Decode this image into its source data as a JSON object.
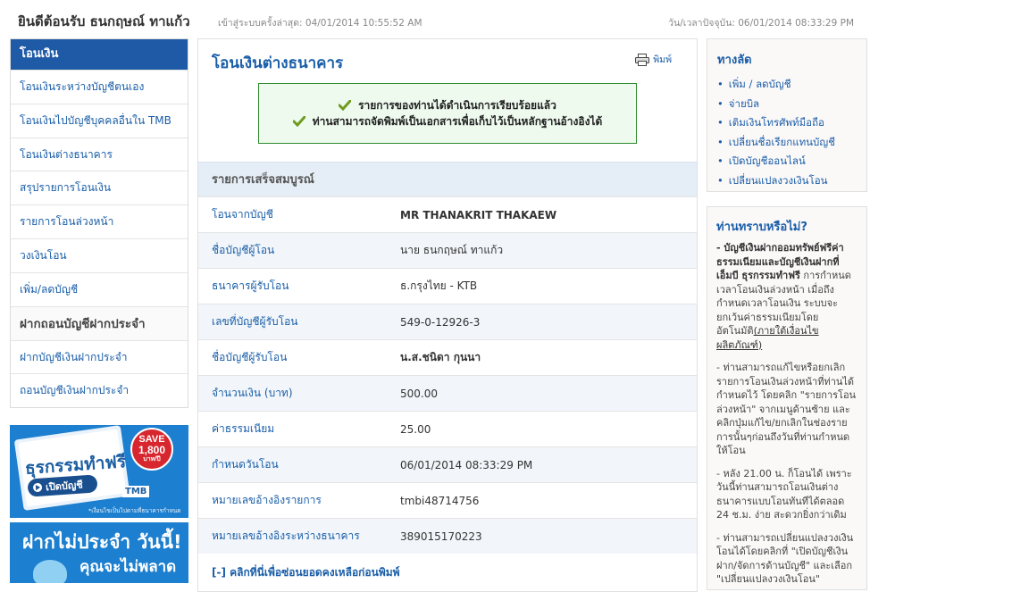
{
  "header": {
    "welcome": "ยินดีต้อนรับ ธนกฤษณ์ ทาแก้ว",
    "last_login": "เข้าสู่ระบบครั้งล่าสุด: 04/01/2014 10:55:52 AM",
    "current_time": "วัน/เวลาปัจจุบัน: 06/01/2014 08:33:29 PM"
  },
  "sidebar": {
    "title": "โอนเงิน",
    "items": [
      {
        "label": "โอนเงินระหว่างบัญชีตนเอง"
      },
      {
        "label": "โอนเงินไปบัญชีบุคคลอื่นใน TMB"
      },
      {
        "label": "โอนเงินต่างธนาคาร"
      },
      {
        "label": "สรุปรายการโอนเงิน"
      },
      {
        "label": "รายการโอนล่วงหน้า"
      },
      {
        "label": "วงเงินโอน"
      },
      {
        "label": "เพิ่ม/ลดบัญชี"
      }
    ],
    "section_title": "ฝากถอนบัญชีฝากประจำ",
    "section_items": [
      {
        "label": "ฝากบัญชีเงินฝากประจำ"
      },
      {
        "label": "ถอนบัญชีเงินฝากประจำ"
      }
    ]
  },
  "banner1": {
    "save_text": "SAVE",
    "save_amount": "1,800",
    "save_unit": "บาท/ปี",
    "title": "ธุรกรรมทำฟรี",
    "button": "เปิดบัญชี",
    "brand": "TMB",
    "note": "*เงื่อนไขเป็นไปตามที่ธนาคารกำหนด"
  },
  "banner2": {
    "line1": "ฝากไม่ประจำ วันนี้!",
    "line2": "คุณจะไม่พลาด"
  },
  "main": {
    "title": "โอนเงินต่างธนาคาร",
    "print_label": "พิมพ์",
    "success_lines": [
      "รายการของท่านได้ดำเนินการเรียบร้อยแล้ว",
      "ท่านสามารถจัดพิมพ์เป็นเอกสารเพื่อเก็บไว้เป็นหลักฐานอ้างอิงได้"
    ],
    "section_title": "รายการเสร็จสมบูรณ์",
    "rows": [
      {
        "label": "โอนจากบัญชี",
        "value": "MR THANAKRIT THAKAEW"
      },
      {
        "label": "ชื่อบัญชีผู้โอน",
        "value": "นาย ธนกฤษณ์ ทาแก้ว"
      },
      {
        "label": "ธนาคารผู้รับโอน",
        "value": "ธ.กรุงไทย - KTB"
      },
      {
        "label": "เลขที่บัญชีผู้รับโอน",
        "value": "549-0-12926-3"
      },
      {
        "label": "ชื่อบัญชีผู้รับโอน",
        "value": "น.ส.ชนิดา กุนนา"
      },
      {
        "label": "จำนวนเงิน (บาท)",
        "value": "500.00"
      },
      {
        "label": "ค่าธรรมเนียม",
        "value": "25.00"
      },
      {
        "label": "กำหนดวันโอน",
        "value": "06/01/2014 08:33:29 PM"
      },
      {
        "label": "หมายเลขอ้างอิงรายการ",
        "value": "tmbi48714756"
      },
      {
        "label": "หมายเลขอ้างอิงระหว่างธนาคาร",
        "value": "389015170223"
      }
    ],
    "hide_balance_link": "[-] คลิกที่นี่เพื่อซ่อนยอดคงเหลือก่อนพิมพ์"
  },
  "shortcuts": {
    "title": "ทางลัด",
    "items": [
      {
        "label": "เพิ่ม / ลดบัญชี"
      },
      {
        "label": "จ่ายบิล"
      },
      {
        "label": "เติมเงินโทรศัพท์มือถือ"
      },
      {
        "label": "เปลี่ยนชื่อเรียกแทนบัญชี"
      },
      {
        "label": "เปิดบัญชีออนไลน์"
      },
      {
        "label": "เปลี่ยนแปลงวงเงินโอน"
      }
    ]
  },
  "did_you_know": {
    "title": "ท่านทราบหรือไม่?",
    "p1_bold": "- บัญชีเงินฝากออมทรัพย์ฟรีค่าธรรมเนียมและบัญชีเงินฝากที่เอ็มบี ธุรกรรมทำฟรี",
    "p1_rest": " การกำหนดเวลาโอนเงินล่วงหน้า เมื่อถึงกำหนดเวลาโอนเงิน ระบบจะยกเว้นค่าธรรมเนียมโดยอัตโนมัติ",
    "p1_link": "(ภายใต้เงื่อนไขผลิตภัณฑ์)",
    "p2": "- ท่านสามารถแก้ไขหรือยกเลิกรายการโอนเงินล่วงหน้าที่ท่านได้กำหนดไว้ โดยคลิก \"รายการโอนล่วงหน้า\" จากเมนูด้านซ้าย และคลิกปุ่มแก้ไข/ยกเลิกในช่องรายการนั้นๆก่อนถึงวันที่ท่านกำหนดให้โอน",
    "p3": "- หลัง 21.00 น. ก็โอนได้ เพราะวันนี้ท่านสามารถโอนเงินต่างธนาคารแบบโอนทันทีได้ตลอด 24 ช.ม. ง่าย สะดวกยิ่งกว่าเดิม",
    "p4": "- ท่านสามารถเปลี่ยนแปลงวงเงินโอนได้โดยคลิกที่ \"เปิดบัญชีเงินฝาก/จัดการด้านบัญชี\" และเลือก \"เปลี่ยนแปลงวงเงินโอน\""
  },
  "colors": {
    "accent": "#1a5ea8",
    "nav_header": "#1f5aa6",
    "success_border": "#2e8b2e",
    "success_bg": "#eefaee",
    "check": "#6f9a1f"
  }
}
